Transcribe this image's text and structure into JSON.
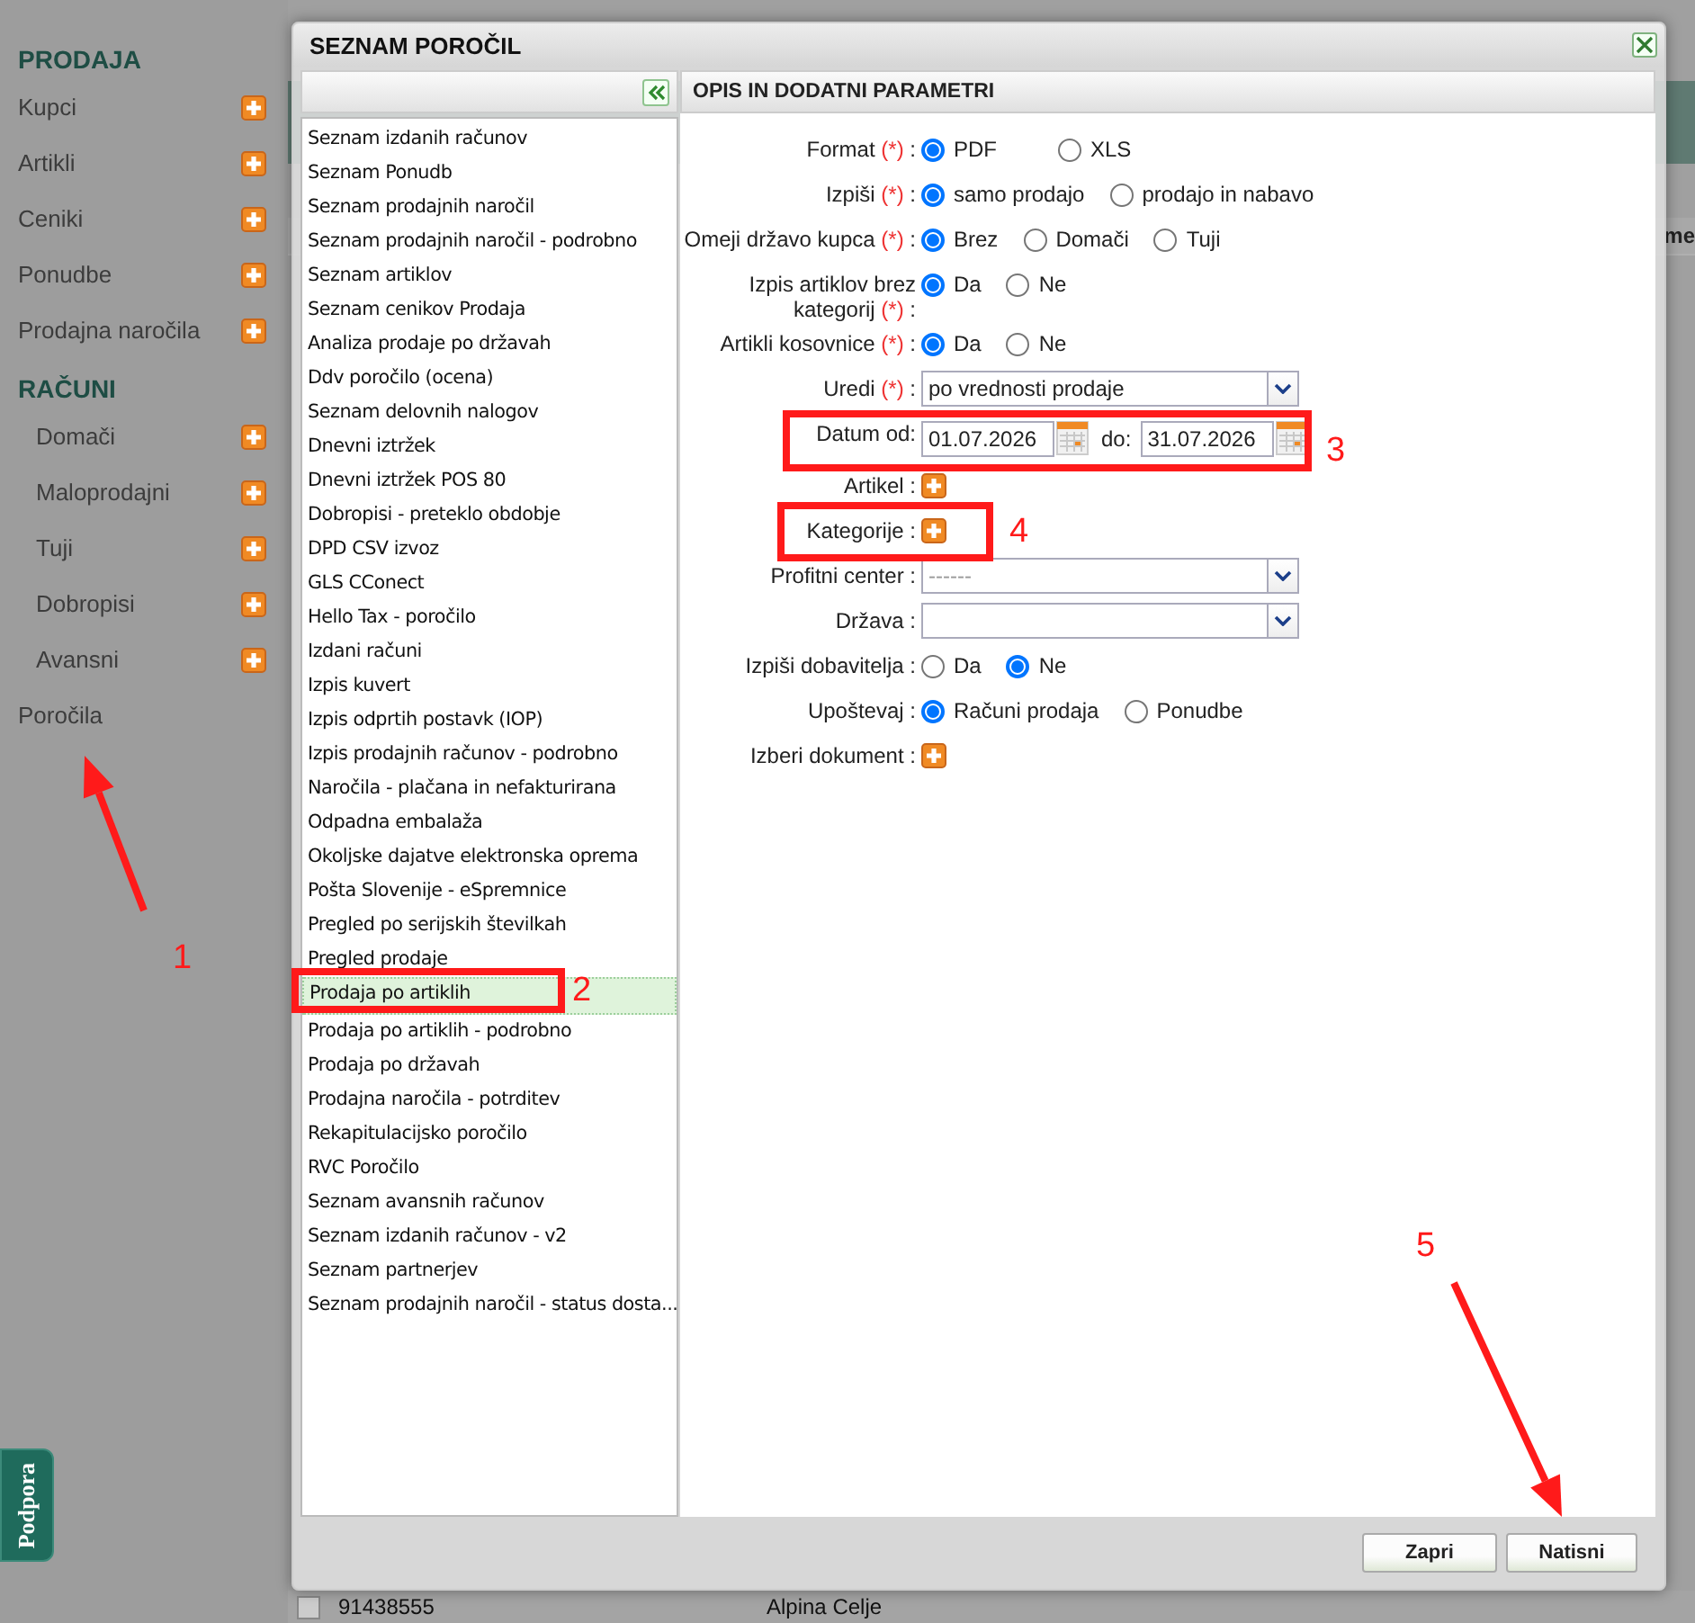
{
  "sidebar": {
    "sections": [
      {
        "heading": "PRODAJA",
        "kind": "main",
        "items": [
          {
            "label": "Kupci",
            "add": true
          },
          {
            "label": "Artikli",
            "add": true
          },
          {
            "label": "Ceniki",
            "add": true
          },
          {
            "label": "Ponudbe",
            "add": true
          },
          {
            "label": "Prodajna naročila",
            "add": true
          }
        ]
      },
      {
        "heading": "RAČUNI",
        "kind": "sub",
        "items": [
          {
            "label": "Domači",
            "add": true
          },
          {
            "label": "Maloprodajni",
            "add": true
          },
          {
            "label": "Tuji",
            "add": true
          },
          {
            "label": "Dobropisi",
            "add": true
          },
          {
            "label": "Avansni",
            "add": true
          }
        ]
      }
    ],
    "links": [
      {
        "label": "Poročila"
      }
    ]
  },
  "support_tab": {
    "label": "Podpora"
  },
  "background": {
    "column_header": "me",
    "rows": [
      {
        "code": "91438555",
        "name": "Alpina Celje",
        "checked": false
      }
    ]
  },
  "dialog": {
    "title": "SEZNAM POROČIL",
    "reports": [
      {
        "label": "Seznam izdanih računov",
        "selected": false
      },
      {
        "label": "Seznam Ponudb",
        "selected": false
      },
      {
        "label": "Seznam prodajnih naročil",
        "selected": false
      },
      {
        "label": "Seznam prodajnih naročil - podrobno",
        "selected": false
      },
      {
        "label": "Seznam artiklov",
        "selected": false
      },
      {
        "label": "Seznam cenikov Prodaja",
        "selected": false
      },
      {
        "label": "Analiza prodaje po državah",
        "selected": false
      },
      {
        "label": "Ddv poročilo (ocena)",
        "selected": false
      },
      {
        "label": "Seznam delovnih nalogov",
        "selected": false
      },
      {
        "label": "Dnevni iztržek",
        "selected": false
      },
      {
        "label": "Dnevni iztržek POS 80",
        "selected": false
      },
      {
        "label": "Dobropisi - preteklo obdobje",
        "selected": false
      },
      {
        "label": "DPD CSV izvoz",
        "selected": false
      },
      {
        "label": "GLS CConect",
        "selected": false
      },
      {
        "label": "Hello Tax - poročilo",
        "selected": false
      },
      {
        "label": "Izdani računi",
        "selected": false
      },
      {
        "label": "Izpis kuvert",
        "selected": false
      },
      {
        "label": "Izpis odprtih postavk (IOP)",
        "selected": false
      },
      {
        "label": "Izpis prodajnih računov - podrobno",
        "selected": false
      },
      {
        "label": "Naročila - plačana in nefakturirana",
        "selected": false
      },
      {
        "label": "Odpadna embalaža",
        "selected": false
      },
      {
        "label": "Okoljske dajatve elektronska oprema",
        "selected": false
      },
      {
        "label": "Pošta Slovenije - eSpremnice",
        "selected": false
      },
      {
        "label": "Pregled po serijskih številkah",
        "selected": false
      },
      {
        "label": "Pregled prodaje",
        "selected": false
      },
      {
        "label": "Prodaja po artiklih",
        "selected": true
      },
      {
        "label": "Prodaja po artiklih - podrobno",
        "selected": false
      },
      {
        "label": "Prodaja po državah",
        "selected": false
      },
      {
        "label": "Prodajna naročila - potrditev",
        "selected": false
      },
      {
        "label": "Rekapitulacijsko poročilo",
        "selected": false
      },
      {
        "label": "RVC Poročilo",
        "selected": false
      },
      {
        "label": "Seznam avansnih računov",
        "selected": false
      },
      {
        "label": "Seznam izdanih računov - v2",
        "selected": false
      },
      {
        "label": "Seznam partnerjev",
        "selected": false
      },
      {
        "label": "Seznam prodajnih naročil - status dosta...",
        "selected": false
      }
    ],
    "panel_title": "OPIS IN DODATNI PARAMETRI",
    "fields": [
      {
        "kind": "radio",
        "label": "Format",
        "required": "(*)",
        "suffix": ":",
        "options": [
          {
            "label": "PDF",
            "selected": true
          },
          {
            "label": "XLS",
            "selected": false
          }
        ]
      },
      {
        "kind": "radio",
        "label": "Izpiši",
        "required": "(*)",
        "suffix": ":",
        "options": [
          {
            "label": "samo prodajo",
            "selected": true
          },
          {
            "label": "prodajo in nabavo",
            "selected": false
          }
        ]
      },
      {
        "kind": "radio",
        "label": "Omeji državo kupca",
        "required": "(*)",
        "suffix": ":",
        "options": [
          {
            "label": "Brez",
            "selected": true
          },
          {
            "label": "Domači",
            "selected": false
          },
          {
            "label": "Tuji",
            "selected": false
          }
        ]
      },
      {
        "kind": "radio",
        "label": "Izpis artiklov brez kategorij",
        "required": "(*)",
        "suffix": ":",
        "options": [
          {
            "label": "Da",
            "selected": true
          },
          {
            "label": "Ne",
            "selected": false
          }
        ]
      },
      {
        "kind": "radio",
        "label": "Artikli kosovnice",
        "required": "(*)",
        "suffix": ":",
        "options": [
          {
            "label": "Da",
            "selected": true
          },
          {
            "label": "Ne",
            "selected": false
          }
        ]
      },
      {
        "kind": "select",
        "label": "Uredi",
        "required": "(*)",
        "suffix": ":",
        "value": "po vrednosti prodaje"
      },
      {
        "kind": "daterange",
        "label": "Datum od:",
        "from": "01.07.2026",
        "to_label": "do:",
        "to": "31.07.2026"
      },
      {
        "kind": "add",
        "label": "Artikel",
        "suffix": ":"
      },
      {
        "kind": "add",
        "label": "Kategorije",
        "suffix": ":"
      },
      {
        "kind": "select",
        "label": "Profitni center",
        "suffix": ":",
        "placeholder": "------"
      },
      {
        "kind": "select",
        "label": "Država",
        "suffix": ":"
      },
      {
        "kind": "radio",
        "label": "Izpiši dobavitelja",
        "suffix": ":",
        "options": [
          {
            "label": "Da",
            "selected": false
          },
          {
            "label": "Ne",
            "selected": true
          }
        ]
      },
      {
        "kind": "radio",
        "label": "Upoštevaj",
        "suffix": ":",
        "options": [
          {
            "label": "Računi prodaja",
            "selected": true
          },
          {
            "label": "Ponudbe",
            "selected": false
          }
        ]
      },
      {
        "kind": "add",
        "label": "Izberi dokument",
        "suffix": ":"
      }
    ],
    "buttons": [
      "Zapri",
      "Natisni"
    ]
  },
  "annotations": [
    {
      "label": "1"
    },
    {
      "label": "2"
    },
    {
      "label": "3"
    },
    {
      "label": "4"
    },
    {
      "label": "5"
    }
  ]
}
